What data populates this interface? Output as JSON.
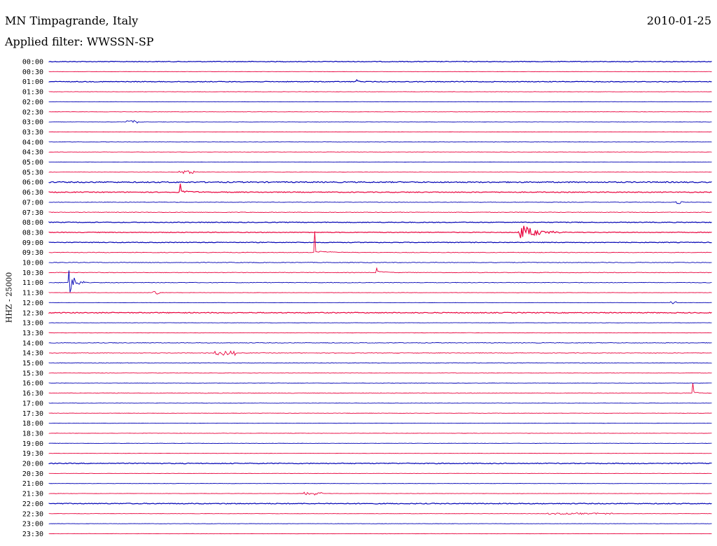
{
  "header": {
    "station": "MN Timpagrande, Italy",
    "date": "2010-01-25",
    "filter_prefix": "Applied filter:",
    "filter_name": "WWSSN-SP"
  },
  "chart_data": {
    "type": "line",
    "title": "MN Timpagrande, Italy",
    "date": "2010-01-25",
    "filter": "WWSSN-SP",
    "ylabel": "HHZ - 25000",
    "tick_labels": [
      "00:00",
      "00:30",
      "01:00",
      "01:30",
      "02:00",
      "02:30",
      "03:00",
      "03:30",
      "04:00",
      "04:30",
      "05:00",
      "05:30",
      "06:00",
      "06:30",
      "07:00",
      "07:30",
      "08:00",
      "08:30",
      "09:00",
      "09:30",
      "10:00",
      "10:30",
      "11:00",
      "11:30",
      "12:00",
      "12:30",
      "13:00",
      "13:30",
      "14:00",
      "14:30",
      "15:00",
      "15:30",
      "16:00",
      "16:30",
      "17:00",
      "17:30",
      "18:00",
      "18:30",
      "19:00",
      "19:30",
      "20:00",
      "20:30",
      "21:00",
      "21:30",
      "22:00",
      "22:30",
      "23:00",
      "23:30"
    ],
    "trace_colors": [
      "#0000b4",
      "#e8003c"
    ],
    "trace_minutes": 30,
    "noise_levels": [
      1.0,
      0.4,
      1.0,
      0.4,
      0.4,
      0.4,
      0.4,
      0.4,
      0.4,
      0.4,
      0.4,
      0.4,
      1.5,
      1.2,
      0.6,
      0.8,
      1.0,
      1.0,
      1.0,
      0.8,
      0.8,
      0.8,
      0.8,
      0.4,
      0.4,
      1.2,
      0.4,
      0.6,
      0.8,
      0.8,
      0.8,
      0.4,
      0.4,
      0.8,
      0.4,
      0.4,
      0.4,
      0.4,
      0.4,
      0.4,
      1.2,
      0.4,
      0.4,
      0.4,
      1.2,
      0.4,
      0.4,
      0.4
    ],
    "events": [
      {
        "trace": "01:00",
        "minute": 13.9,
        "amplitude": 3,
        "duration_min": 0.3,
        "kind": "spike"
      },
      {
        "trace": "03:00",
        "minute": 3.5,
        "amplitude": 2,
        "duration_min": 0.5,
        "kind": "burst"
      },
      {
        "trace": "05:30",
        "minute": 5.8,
        "amplitude": 2,
        "duration_min": 1.0,
        "kind": "burst"
      },
      {
        "trace": "06:30",
        "minute": 5.9,
        "amplitude": 12,
        "duration_min": 1.2,
        "kind": "spike"
      },
      {
        "trace": "07:00",
        "minute": 28.3,
        "amplitude": 2,
        "duration_min": 0.4,
        "kind": "burst"
      },
      {
        "trace": "08:30",
        "minute": 21.2,
        "amplitude": 14,
        "duration_min": 2.2,
        "kind": "quake"
      },
      {
        "trace": "09:30",
        "minute": 12.0,
        "amplitude": 30,
        "duration_min": 1.8,
        "kind": "spike"
      },
      {
        "trace": "10:30",
        "minute": 14.8,
        "amplitude": 6,
        "duration_min": 1.0,
        "kind": "spike"
      },
      {
        "trace": "11:00",
        "minute": 0.9,
        "amplitude": 22,
        "duration_min": 0.8,
        "kind": "quake"
      },
      {
        "trace": "11:30",
        "minute": 4.7,
        "amplitude": 2,
        "duration_min": 0.3,
        "kind": "burst"
      },
      {
        "trace": "12:00",
        "minute": 28.1,
        "amplitude": 2,
        "duration_min": 0.3,
        "kind": "burst"
      },
      {
        "trace": "14:30",
        "minute": 7.5,
        "amplitude": 3,
        "duration_min": 1.0,
        "kind": "burst"
      },
      {
        "trace": "16:30",
        "minute": 29.1,
        "amplitude": 14,
        "duration_min": 0.6,
        "kind": "spike"
      },
      {
        "trace": "21:30",
        "minute": 11.5,
        "amplitude": 2,
        "duration_min": 0.3,
        "kind": "burst"
      },
      {
        "trace": "21:30",
        "minute": 12.0,
        "amplitude": 2,
        "duration_min": 0.4,
        "kind": "burst"
      },
      {
        "trace": "22:30",
        "minute": 22.5,
        "amplitude": 1,
        "duration_min": 3.0,
        "kind": "burst"
      }
    ]
  }
}
